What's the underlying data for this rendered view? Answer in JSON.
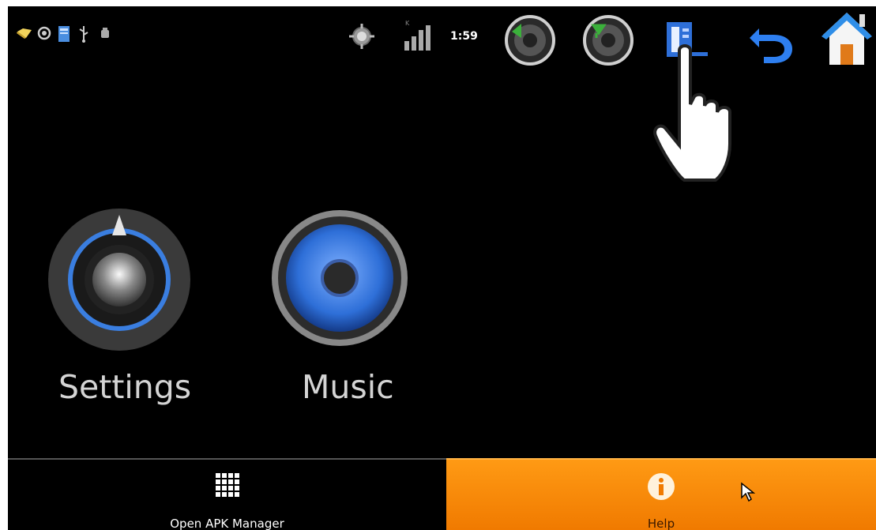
{
  "status_bar": {
    "time": "1:59",
    "left_icons": [
      "folder-icon",
      "sync-icon",
      "sd-card-icon",
      "usb-icon",
      "android-debug-icon"
    ],
    "right_icons": [
      "gps-icon",
      "signal-icon",
      "volume-down-icon",
      "volume-up-icon",
      "menu-icon",
      "back-icon",
      "home-icon"
    ]
  },
  "apps": [
    {
      "label": "Settings",
      "icon": "settings-knob-icon"
    },
    {
      "label": "Music",
      "icon": "speaker-icon"
    }
  ],
  "bottom_bar": {
    "apk_button": {
      "label": "Open APK Manager",
      "icon": "grid-icon"
    },
    "help_button": {
      "label": "Help",
      "icon": "info-icon"
    }
  },
  "colors": {
    "background": "#000000",
    "help_accent": "#ff8c00",
    "icon_blue": "#2e6fd8"
  }
}
